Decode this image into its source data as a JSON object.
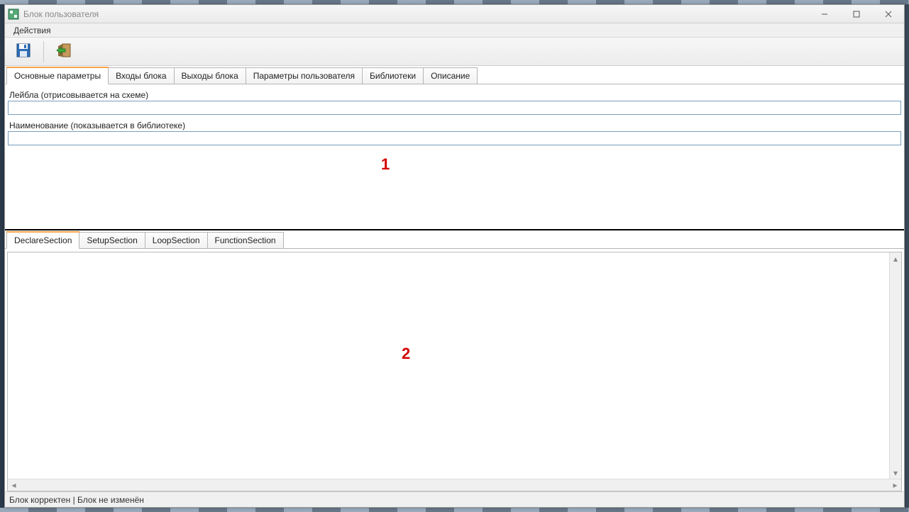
{
  "window": {
    "title": "Блок пользователя"
  },
  "menubar": {
    "actions": "Действия"
  },
  "top_tabs": [
    "Основные параметры",
    "Входы блока",
    "Выходы блока",
    "Параметры пользователя",
    "Библиотеки",
    "Описание"
  ],
  "top_form": {
    "label_field_label": "Лейбла (отрисовывается на схеме)",
    "label_field_value": "",
    "name_field_label": "Наименование (показывается в библиотеке)",
    "name_field_value": ""
  },
  "bottom_tabs": [
    "DeclareSection",
    "SetupSection",
    "LoopSection",
    "FunctionSection"
  ],
  "annotations": {
    "top": "1",
    "bottom": "2"
  },
  "statusbar": {
    "text": "Блок корректен | Блок не изменён"
  }
}
